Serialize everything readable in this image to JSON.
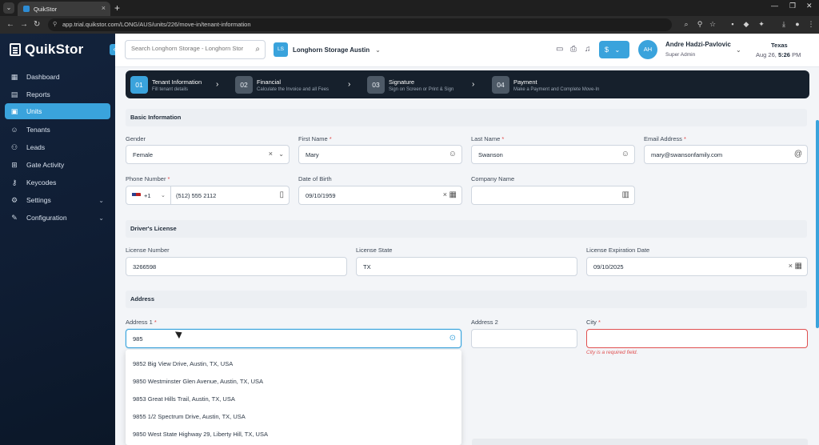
{
  "browser": {
    "tab_title": "QuikStor",
    "url": "app.trial.quikstor.com/LONG/AUS/units/226/move-in/tenant-information"
  },
  "sidebar": {
    "logo": "QuikStor",
    "items": [
      {
        "label": "Dashboard",
        "icon": "dashboard-icon"
      },
      {
        "label": "Reports",
        "icon": "chart-icon"
      },
      {
        "label": "Units",
        "icon": "units-icon"
      },
      {
        "label": "Tenants",
        "icon": "users-icon"
      },
      {
        "label": "Leads",
        "icon": "leads-icon"
      },
      {
        "label": "Gate Activity",
        "icon": "gate-icon"
      },
      {
        "label": "Keycodes",
        "icon": "key-icon"
      },
      {
        "label": "Settings",
        "icon": "gear-icon"
      },
      {
        "label": "Configuration",
        "icon": "wrench-icon"
      }
    ],
    "active": "Units"
  },
  "header": {
    "search_placeholder": "Search Longhorn Storage - Longhorn Storage Austin",
    "facility_badge": "LS",
    "facility_name": "Longhorn Storage Austin",
    "avatar_initials": "AH",
    "user_name": "Andre Hadzi-Pavlovic",
    "user_role": "Super Admin",
    "state": "Texas",
    "date": "Aug 26,",
    "time": "5:26",
    "ampm": "PM"
  },
  "steps": [
    {
      "num": "01",
      "title": "Tenant Information",
      "sub": "Fill tenant details"
    },
    {
      "num": "02",
      "title": "Financial",
      "sub": "Calculate the Invoice and all Fees"
    },
    {
      "num": "03",
      "title": "Signature",
      "sub": "Sign on Screen or Print & Sign"
    },
    {
      "num": "04",
      "title": "Payment",
      "sub": "Make a Payment and Complete Move-In"
    }
  ],
  "sections": {
    "basic": "Basic Information",
    "license": "Driver's License",
    "address": "Address"
  },
  "form": {
    "gender_label": "Gender",
    "gender": "Female",
    "first_name_label": "First Name",
    "first_name": "Mary",
    "last_name_label": "Last Name",
    "last_name": "Swanson",
    "email_label": "Email Address",
    "email": "mary@swansonfamily.com",
    "phone_label": "Phone Number",
    "phone_code": "+1",
    "phone": "(512) 555 2112",
    "dob_label": "Date of Birth",
    "dob": "09/10/1959",
    "company_label": "Company Name",
    "company": "",
    "license_number_label": "License Number",
    "license_number": "3266598",
    "license_state_label": "License State",
    "license_state": "TX",
    "license_exp_label": "License Expiration Date",
    "license_exp": "09/10/2025",
    "address1_label": "Address 1",
    "address1": "985",
    "address2_label": "Address 2",
    "address2": "",
    "city_label": "City",
    "city": "",
    "city_error": "City is a required field.",
    "required_mark": "*"
  },
  "suggestions": [
    "9852 Big View Drive, Austin, TX, USA",
    "9850 Westminster Glen Avenue, Austin, TX, USA",
    "9853 Great Hills Trail, Austin, TX, USA",
    "9855 1/2 Spectrum Drive, Austin, TX, USA",
    "9850 West State Highway 29, Liberty Hill, TX, USA"
  ],
  "colors": {
    "accent": "#3aa3dc",
    "sidebar": "#13233c",
    "stepper": "#16202c",
    "error": "#e05050"
  }
}
